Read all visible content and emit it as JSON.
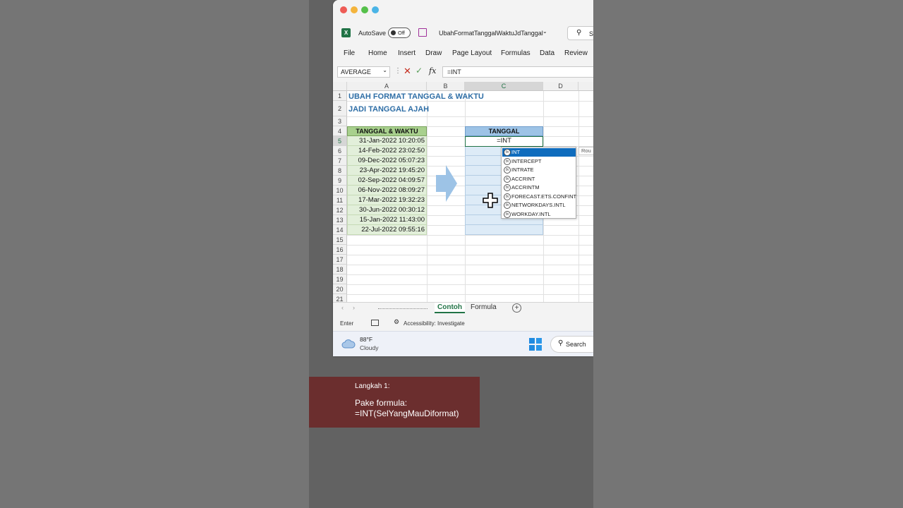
{
  "window": {
    "autosave_label": "AutoSave",
    "autosave_state": "Off",
    "filename": "UbahFormatTanggalWaktuJdTanggal",
    "search_label": "S"
  },
  "menu": [
    "File",
    "Home",
    "Insert",
    "Draw",
    "Page Layout",
    "Formulas",
    "Data",
    "Review"
  ],
  "formula_bar": {
    "name_box": "AVERAGE",
    "formula": "=INT"
  },
  "columns": [
    "A",
    "B",
    "C",
    "D"
  ],
  "rows": [
    "1",
    "2",
    "3",
    "4",
    "5",
    "6",
    "7",
    "8",
    "9",
    "10",
    "11",
    "12",
    "13",
    "14",
    "15",
    "16",
    "17",
    "18",
    "19",
    "20",
    "21"
  ],
  "sheet": {
    "title1": "UBAH FORMAT TANGGAL & WAKTU",
    "title2": "JADI TANGGAL AJAH",
    "col_a_header": "TANGGAL & WAKTU",
    "col_c_header": "TANGGAL",
    "datetimes": [
      "31-Jan-2022 10:20:05",
      "14-Feb-2022 23:02:50",
      "09-Dec-2022 05:07:23",
      "23-Apr-2022 19:45:20",
      "02-Sep-2022 04:09:57",
      "06-Nov-2022 08:09:27",
      "17-Mar-2022 19:32:23",
      "30-Jun-2022 00:30:12",
      "15-Jan-2022 11:43:00",
      "22-Jul-2022 09:55:16"
    ],
    "active_cell_value": "=INT"
  },
  "autocomplete": {
    "items": [
      "INT",
      "INTERCEPT",
      "INTRATE",
      "ACCRINT",
      "ACCRINTM",
      "FORECAST.ETS.CONFINT",
      "NETWORKDAYS.INTL",
      "WORKDAY.INTL"
    ],
    "icon_text": "fx",
    "tooltip": "Rou"
  },
  "tabs": {
    "active": "Contoh",
    "other": "Formula"
  },
  "status": {
    "mode": "Enter",
    "accessibility": "Accessibility: Investigate"
  },
  "taskbar": {
    "temp": "88°F",
    "weather": "Cloudy",
    "search": "Search"
  },
  "caption": {
    "step": "Langkah 1:",
    "line1": "Pake formula:",
    "line2": "=INT(SelYangMauDiformat)"
  },
  "colors": {
    "excel_green": "#217346",
    "title_blue": "#2e6ea6",
    "green_header": "#a8d08d",
    "blue_header": "#9dc3e6",
    "caption_bg": "#6b2e2e",
    "selection_blue": "#0f6cbd"
  }
}
